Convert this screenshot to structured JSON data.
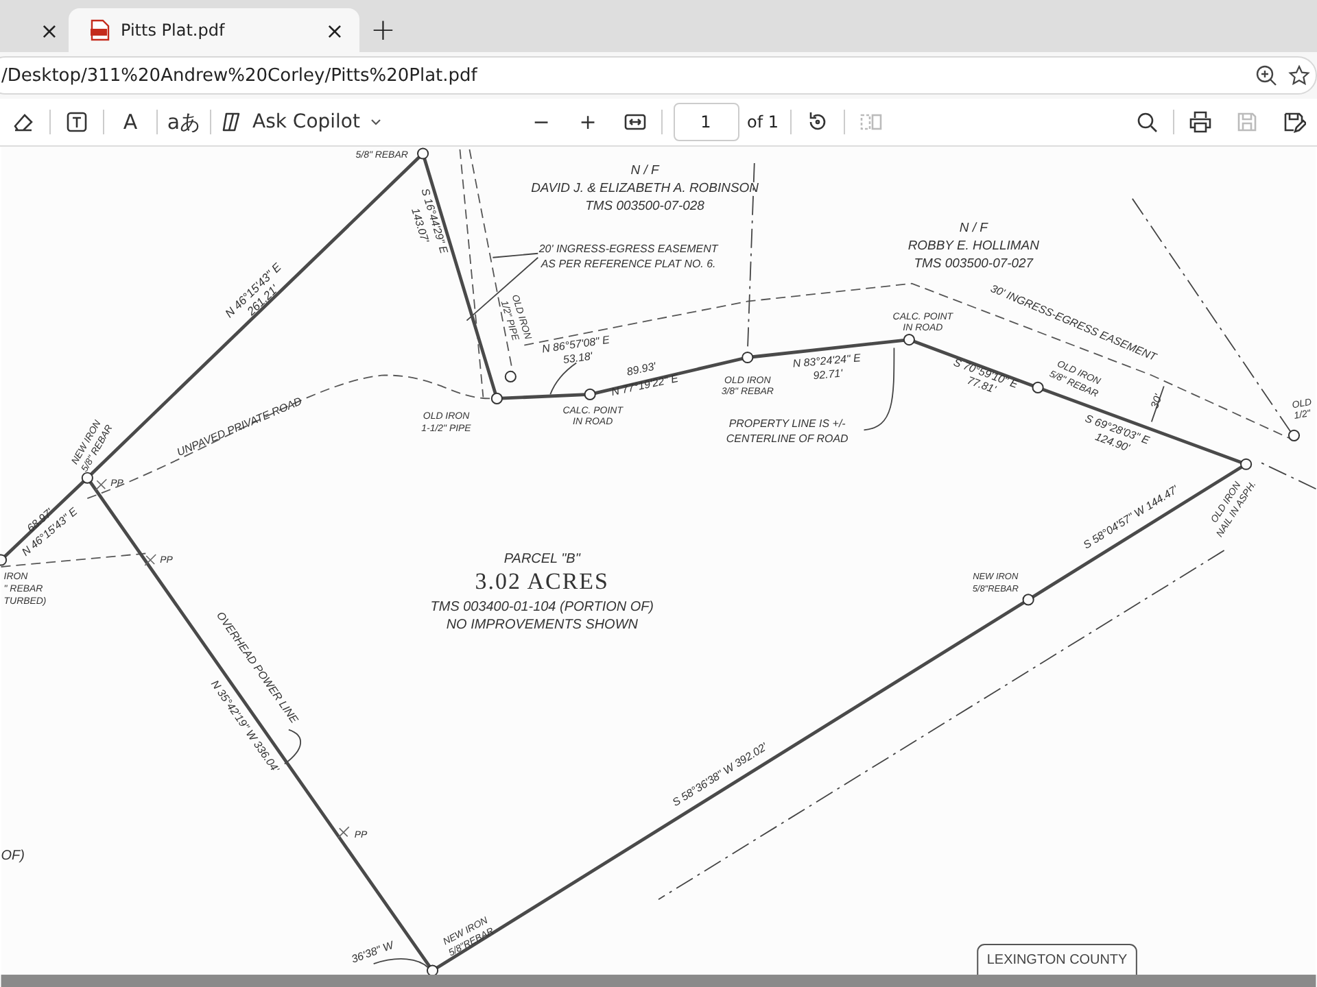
{
  "tabs": [
    {
      "selected": false,
      "close": "×"
    },
    {
      "title": "Pitts Plat.pdf",
      "selected": true,
      "close": "×"
    }
  ],
  "new_tab": "+",
  "address": {
    "url": "/Desktop/311%20Andrew%20Corley/Pitts%20Plat.pdf"
  },
  "toolbar": {
    "left": [
      {
        "kind": "erase",
        "disabled": false,
        "divider_after": true
      },
      {
        "kind": "text-box",
        "disabled": false,
        "divider_after": true
      },
      {
        "kind": "read-aloud",
        "glyph": "A",
        "disabled": false,
        "divider_after": true
      },
      {
        "kind": "translate",
        "glyph": "aあ",
        "disabled": false,
        "divider_after": true
      },
      {
        "kind": "copilot",
        "label": "Ask Copilot",
        "disabled": false,
        "divider_after": false
      }
    ],
    "center": [
      {
        "kind": "zoom-out",
        "glyph": "−",
        "disabled": false,
        "divider_after": false
      },
      {
        "kind": "zoom-in",
        "glyph": "+",
        "disabled": false,
        "divider_after": false
      },
      {
        "kind": "fit-width",
        "disabled": false,
        "divider_after": true
      },
      {
        "kind": "page",
        "value": "1",
        "total": "of 1",
        "disabled": false,
        "divider_after": true
      },
      {
        "kind": "rotate",
        "disabled": false,
        "divider_after": true
      },
      {
        "kind": "two-page",
        "disabled": true,
        "divider_after": false
      }
    ],
    "right": [
      {
        "kind": "search",
        "disabled": false,
        "divider_after": true
      },
      {
        "kind": "print",
        "disabled": false,
        "divider_after": false
      },
      {
        "kind": "save",
        "disabled": true,
        "divider_after": false
      },
      {
        "kind": "save-as",
        "disabled": false,
        "divider_after": false
      }
    ]
  },
  "plat": {
    "labels": [
      {
        "lines": [
          "5/8\" REBAR"
        ]
      },
      {
        "lines": [
          "N / F",
          "DAVID J. & ELIZABETH A. ROBINSON",
          "TMS 003500-07-028"
        ]
      },
      {
        "lines": [
          "20' INGRESS-EGRESS EASEMENT",
          "AS PER REFERENCE PLAT NO. 6."
        ]
      },
      {
        "lines": [
          "S 16°44'29\" E",
          "143.07'"
        ]
      },
      {
        "lines": [
          "OLD IRON",
          "1/2\" PIPE"
        ]
      },
      {
        "lines": [
          "N 86°57'08\" E",
          "53.18'"
        ]
      },
      {
        "lines": [
          "89.93'",
          "N 77°19'22\" E"
        ]
      },
      {
        "lines": [
          "OLD IRON",
          "3/8\" REBAR"
        ]
      },
      {
        "lines": [
          "N 83°24'24\" E",
          "92.71'"
        ]
      },
      {
        "lines": [
          "CALC. POINT",
          "IN ROAD"
        ]
      },
      {
        "lines": [
          "OLD IRON",
          "1-1/2\" PIPE"
        ]
      },
      {
        "lines": [
          "PROPERTY LINE IS +/-",
          "CENTERLINE OF ROAD"
        ]
      },
      {
        "lines": [
          "N / F",
          "ROBBY E. HOLLIMAN",
          "TMS 003500-07-027"
        ]
      },
      {
        "lines": [
          "CALC. POINT",
          "IN ROAD"
        ]
      },
      {
        "lines": [
          "30' INGRESS-EGRESS EASEMENT"
        ]
      },
      {
        "lines": [
          "S 70°59'10\" E",
          "77.81'"
        ]
      },
      {
        "lines": [
          "OLD IRON",
          "5/8\" REBAR"
        ]
      },
      {
        "lines": [
          "30'"
        ]
      },
      {
        "lines": [
          "S 69°28'03\" E",
          "124.90'"
        ]
      },
      {
        "lines": [
          "OLD",
          "1/2\""
        ]
      },
      {
        "lines": [
          "OLD IRON",
          "NAIL IN ASPH."
        ]
      },
      {
        "lines": [
          "S 58°04'57\" W  144.47'"
        ]
      },
      {
        "lines": [
          "NEW IRON",
          "5/8\"REBAR"
        ]
      },
      {
        "lines": [
          "PARCEL \"B\"",
          "3.02 ACRES",
          "TMS 003400-01-104 (PORTION OF)",
          "NO IMPROVEMENTS SHOWN"
        ]
      },
      {
        "lines": [
          "N 46°15'43\" E",
          "261.21'"
        ]
      },
      {
        "lines": [
          "UNPAVED PRIVATE ROAD"
        ]
      },
      {
        "lines": [
          "NEW IRON",
          "5/8\" REBAR"
        ]
      },
      {
        "lines": [
          "68.97'",
          "N 46°15'43\" E"
        ]
      },
      {
        "lines": [
          "PP"
        ]
      },
      {
        "lines": [
          "PP"
        ]
      },
      {
        "lines": [
          "PP"
        ]
      },
      {
        "lines": [
          "IRON",
          "\" REBAR",
          "TURBED)"
        ]
      },
      {
        "lines": [
          "OVERHEAD POWER LINE"
        ]
      },
      {
        "lines": [
          "N 35°42'19\" W  336.04'"
        ]
      },
      {
        "lines": [
          "OF)"
        ]
      },
      {
        "lines": [
          "36'38\" W"
        ]
      },
      {
        "lines": [
          "NEW IRON",
          "5/8\"REBAR"
        ]
      },
      {
        "lines": [
          "S 58°36'38\" W   392.02'"
        ]
      }
    ],
    "stamp": "LEXINGTON COUNTY"
  }
}
